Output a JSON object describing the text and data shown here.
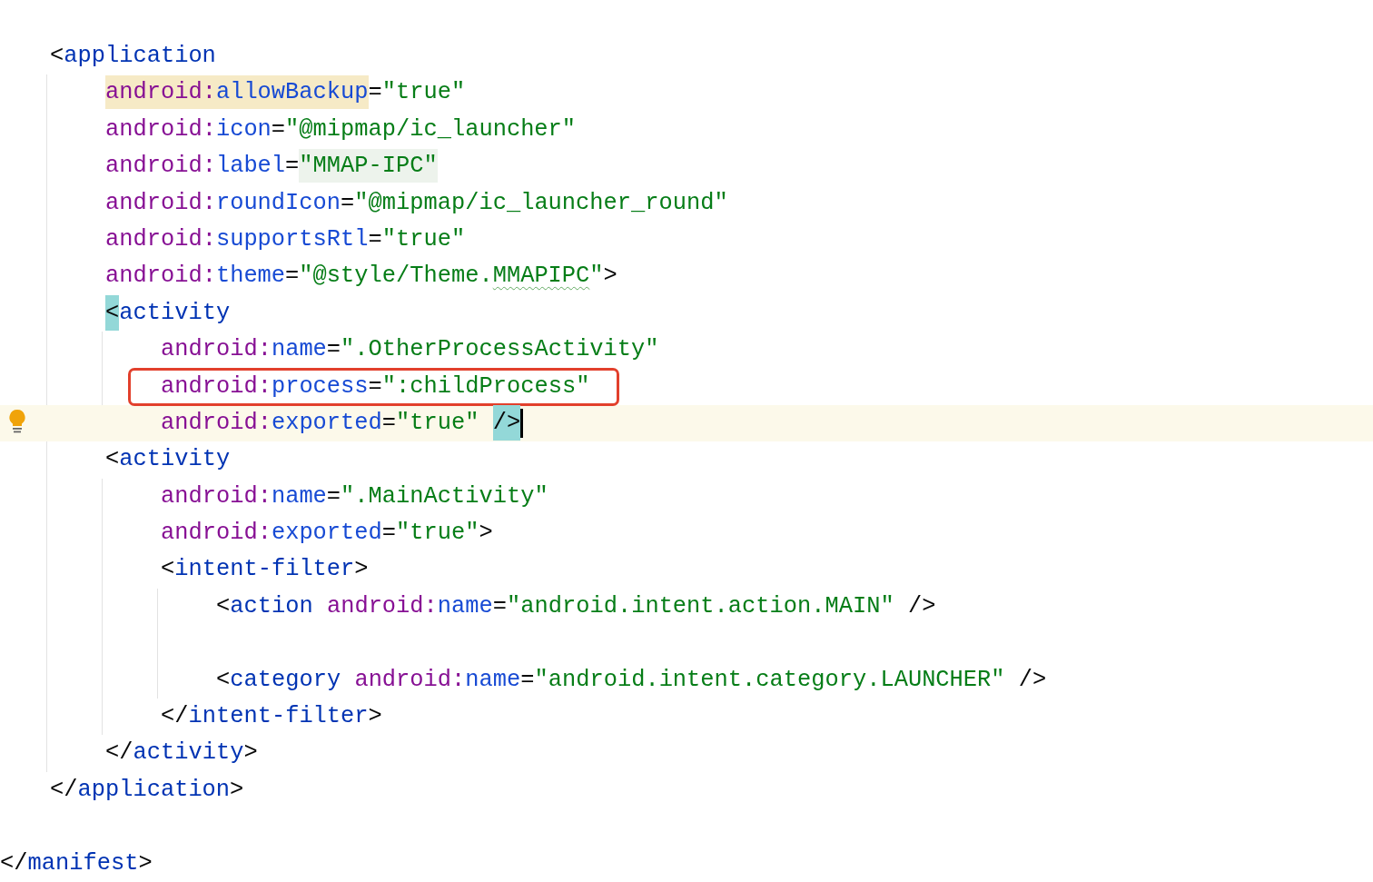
{
  "editor": {
    "lines": [
      {
        "kind": "code",
        "tokens": [
          {
            "kind": "bracket",
            "text": "<"
          },
          {
            "kind": "tag",
            "text": "application"
          }
        ],
        "children": [
          {
            "kind": "code",
            "tokens": [
              {
                "kind": "prefix",
                "text": "android:",
                "occurrence": true
              },
              {
                "kind": "attr",
                "text": "allowBackup",
                "occurrence": true
              },
              {
                "kind": "punct",
                "text": "="
              },
              {
                "kind": "value",
                "text": "\"true\""
              }
            ]
          },
          {
            "kind": "code",
            "tokens": [
              {
                "kind": "prefix",
                "text": "android:"
              },
              {
                "kind": "attr",
                "text": "icon"
              },
              {
                "kind": "punct",
                "text": "="
              },
              {
                "kind": "value",
                "text": "\"@mipmap/ic_launcher\""
              }
            ]
          },
          {
            "kind": "code",
            "tokens": [
              {
                "kind": "prefix",
                "text": "android:"
              },
              {
                "kind": "attr",
                "text": "label"
              },
              {
                "kind": "punct",
                "text": "="
              },
              {
                "kind": "value",
                "text": "\"MMAP-IPC\"",
                "folded": true
              }
            ]
          },
          {
            "kind": "code",
            "tokens": [
              {
                "kind": "prefix",
                "text": "android:"
              },
              {
                "kind": "attr",
                "text": "roundIcon"
              },
              {
                "kind": "punct",
                "text": "="
              },
              {
                "kind": "value",
                "text": "\"@mipmap/ic_launcher_round\""
              }
            ]
          },
          {
            "kind": "code",
            "tokens": [
              {
                "kind": "prefix",
                "text": "android:"
              },
              {
                "kind": "attr",
                "text": "supportsRtl"
              },
              {
                "kind": "punct",
                "text": "="
              },
              {
                "kind": "value",
                "text": "\"true\""
              }
            ]
          },
          {
            "kind": "code",
            "tokens": [
              {
                "kind": "prefix",
                "text": "android:"
              },
              {
                "kind": "attr",
                "text": "theme"
              },
              {
                "kind": "punct",
                "text": "="
              },
              {
                "kind": "value",
                "text": "\"@style/Theme."
              },
              {
                "kind": "value",
                "text": "MMAPIPC",
                "typo": true
              },
              {
                "kind": "value",
                "text": "\""
              },
              {
                "kind": "bracket",
                "text": ">"
              }
            ]
          },
          {
            "kind": "code",
            "tokens": [
              {
                "kind": "bracket",
                "text": "<",
                "brace_match": true
              },
              {
                "kind": "tag",
                "text": "activity"
              }
            ],
            "children": [
              {
                "kind": "code",
                "tokens": [
                  {
                    "kind": "prefix",
                    "text": "android:"
                  },
                  {
                    "kind": "attr",
                    "text": "name"
                  },
                  {
                    "kind": "punct",
                    "text": "="
                  },
                  {
                    "kind": "value",
                    "text": "\".OtherProcessActivity\""
                  }
                ]
              },
              {
                "kind": "code",
                "boxed": true,
                "tokens": [
                  {
                    "kind": "prefix",
                    "text": "android:"
                  },
                  {
                    "kind": "attr",
                    "text": "process"
                  },
                  {
                    "kind": "punct",
                    "text": "="
                  },
                  {
                    "kind": "value",
                    "text": "\":childProcess\""
                  }
                ]
              },
              {
                "kind": "code",
                "current": true,
                "intention": true,
                "caret": true,
                "tokens": [
                  {
                    "kind": "prefix",
                    "text": "android:"
                  },
                  {
                    "kind": "attr",
                    "text": "exported"
                  },
                  {
                    "kind": "punct",
                    "text": "="
                  },
                  {
                    "kind": "value",
                    "text": "\"true\" "
                  },
                  {
                    "kind": "bracket",
                    "text": "/>",
                    "brace_match": true
                  }
                ]
              }
            ]
          },
          {
            "kind": "code",
            "tokens": [
              {
                "kind": "bracket",
                "text": "<"
              },
              {
                "kind": "tag",
                "text": "activity"
              }
            ],
            "children": [
              {
                "kind": "code",
                "tokens": [
                  {
                    "kind": "prefix",
                    "text": "android:"
                  },
                  {
                    "kind": "attr",
                    "text": "name"
                  },
                  {
                    "kind": "punct",
                    "text": "="
                  },
                  {
                    "kind": "value",
                    "text": "\".MainActivity\""
                  }
                ]
              },
              {
                "kind": "code",
                "tokens": [
                  {
                    "kind": "prefix",
                    "text": "android:"
                  },
                  {
                    "kind": "attr",
                    "text": "exported"
                  },
                  {
                    "kind": "punct",
                    "text": "="
                  },
                  {
                    "kind": "value",
                    "text": "\"true\""
                  },
                  {
                    "kind": "bracket",
                    "text": ">"
                  }
                ]
              },
              {
                "kind": "code",
                "tokens": [
                  {
                    "kind": "bracket",
                    "text": "<"
                  },
                  {
                    "kind": "tag",
                    "text": "intent-filter"
                  },
                  {
                    "kind": "bracket",
                    "text": ">"
                  }
                ],
                "children": [
                  {
                    "kind": "code",
                    "tokens": [
                      {
                        "kind": "bracket",
                        "text": "<"
                      },
                      {
                        "kind": "tag",
                        "text": "action "
                      },
                      {
                        "kind": "prefix",
                        "text": "android:"
                      },
                      {
                        "kind": "attr",
                        "text": "name"
                      },
                      {
                        "kind": "punct",
                        "text": "="
                      },
                      {
                        "kind": "value",
                        "text": "\"android.intent.action.MAIN\""
                      },
                      {
                        "kind": "bracket",
                        "text": " />"
                      }
                    ]
                  },
                  {
                    "kind": "blank"
                  },
                  {
                    "kind": "code",
                    "tokens": [
                      {
                        "kind": "bracket",
                        "text": "<"
                      },
                      {
                        "kind": "tag",
                        "text": "category "
                      },
                      {
                        "kind": "prefix",
                        "text": "android:"
                      },
                      {
                        "kind": "attr",
                        "text": "name"
                      },
                      {
                        "kind": "punct",
                        "text": "="
                      },
                      {
                        "kind": "value",
                        "text": "\"android.intent.category.LAUNCHER\""
                      },
                      {
                        "kind": "bracket",
                        "text": " />"
                      }
                    ]
                  }
                ]
              },
              {
                "kind": "code",
                "tokens": [
                  {
                    "kind": "bracket",
                    "text": "</"
                  },
                  {
                    "kind": "tag",
                    "text": "intent-filter"
                  },
                  {
                    "kind": "bracket",
                    "text": ">"
                  }
                ]
              }
            ]
          },
          {
            "kind": "code",
            "tokens": [
              {
                "kind": "bracket",
                "text": "</"
              },
              {
                "kind": "tag",
                "text": "activity"
              },
              {
                "kind": "bracket",
                "text": ">"
              }
            ]
          }
        ]
      },
      {
        "kind": "code",
        "tokens": [
          {
            "kind": "bracket",
            "text": "</"
          },
          {
            "kind": "tag",
            "text": "application"
          },
          {
            "kind": "bracket",
            "text": ">"
          }
        ]
      },
      {
        "kind": "blank"
      }
    ],
    "outer_lines": [
      {
        "kind": "code",
        "tokens": [
          {
            "kind": "bracket",
            "text": "</"
          },
          {
            "kind": "tag",
            "text": "manifest"
          },
          {
            "kind": "bracket",
            "text": ">"
          }
        ]
      }
    ]
  }
}
